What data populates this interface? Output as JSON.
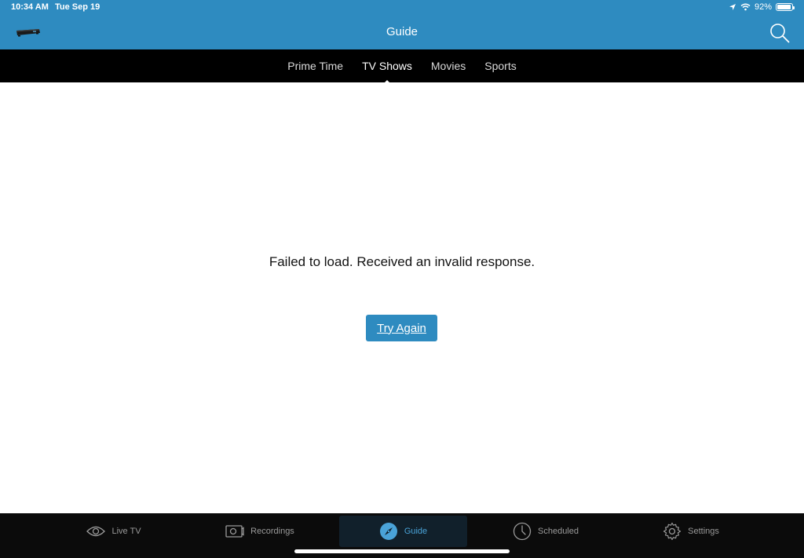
{
  "status": {
    "time": "10:34 AM",
    "date": "Tue Sep 19",
    "battery": "92%",
    "battery_level": 0.92
  },
  "nav": {
    "title": "Guide",
    "left_icon": "set-top-box-icon",
    "right_icon": "search-icon"
  },
  "segments": {
    "items": [
      {
        "label": "Prime Time"
      },
      {
        "label": "TV Shows"
      },
      {
        "label": "Movies"
      },
      {
        "label": "Sports"
      }
    ],
    "selected": "TV Shows"
  },
  "content": {
    "message": "Failed to load. Received an invalid response.",
    "retry_label": "Try Again"
  },
  "tabs": {
    "items": [
      {
        "label": "Live TV",
        "icon": "eye-icon"
      },
      {
        "label": "Recordings",
        "icon": "video-camera-icon"
      },
      {
        "label": "Guide",
        "icon": "compass-icon"
      },
      {
        "label": "Scheduled",
        "icon": "clock-icon"
      },
      {
        "label": "Settings",
        "icon": "gear-icon"
      }
    ],
    "selected": "Guide"
  },
  "colors": {
    "accent": "#2e8bc0",
    "bar_black": "#000000",
    "active_tab": "#4aa3d8"
  }
}
